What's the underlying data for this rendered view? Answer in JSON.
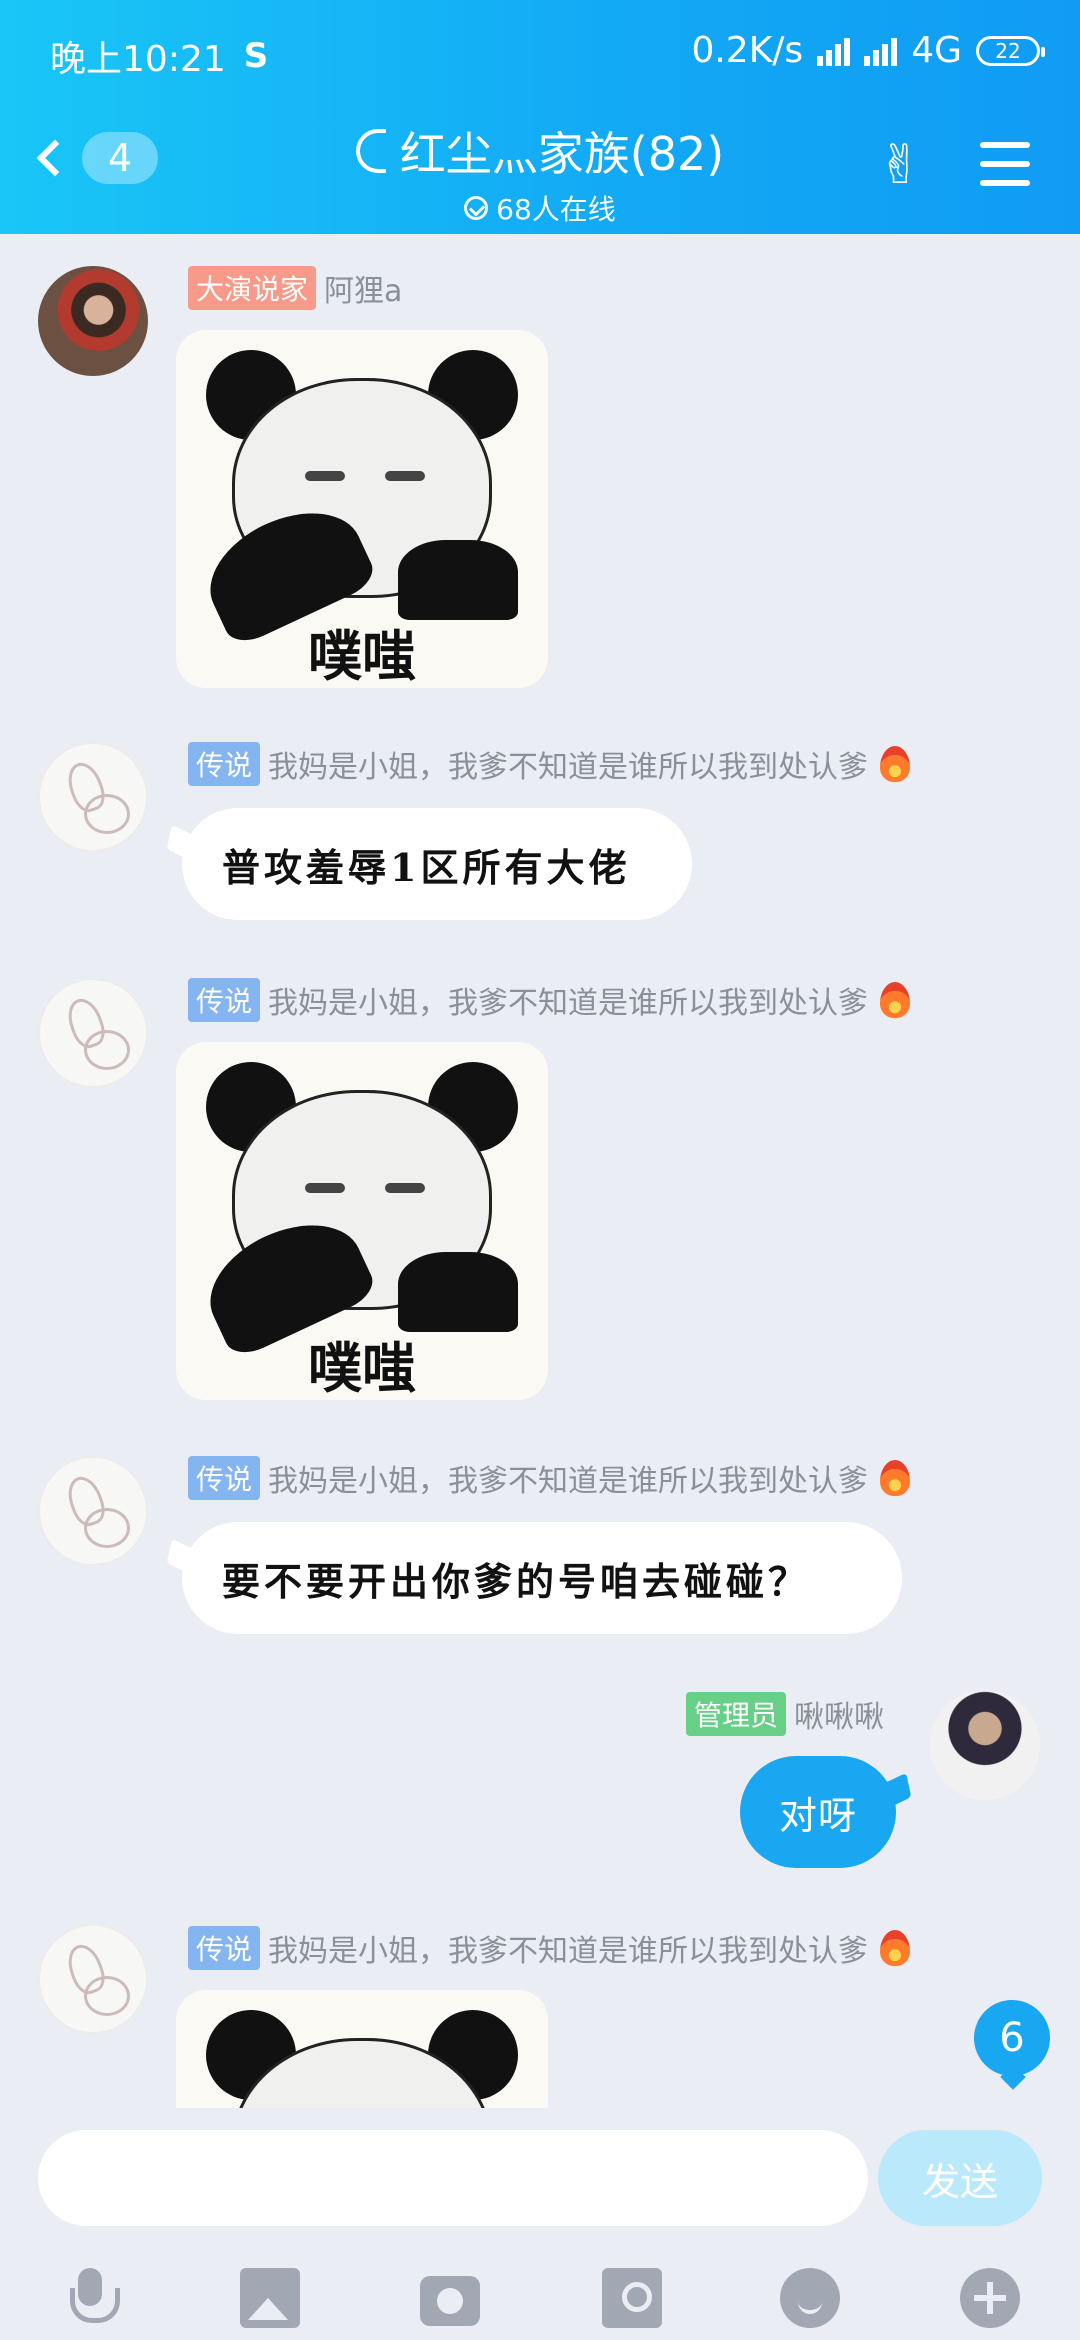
{
  "status_bar": {
    "time": "晚上10:21",
    "app_icon": "sogou-icon",
    "network_speed": "0.2K/s",
    "network_type": "4G",
    "battery": "22"
  },
  "header": {
    "back_count": "4",
    "title": "红尘灬家族(82)",
    "online": "68人在线"
  },
  "messages": [
    {
      "tag": "大演说家",
      "tag_color": "#f79a8a",
      "sender": "阿狸a",
      "type": "sticker",
      "sticker_caption": "噗嗤"
    },
    {
      "tag": "传说",
      "tag_color": "#84b5f0",
      "sender": "我妈是小姐，我爹不知道是谁所以我到处认爹",
      "type": "text",
      "text": "普攻羞辱1区所有大佬"
    },
    {
      "tag": "传说",
      "tag_color": "#84b5f0",
      "sender": "我妈是小姐，我爹不知道是谁所以我到处认爹",
      "type": "sticker",
      "sticker_caption": "噗嗤"
    },
    {
      "tag": "传说",
      "tag_color": "#84b5f0",
      "sender": "我妈是小姐，我爹不知道是谁所以我到处认爹",
      "type": "text",
      "text": "要不要开出你爹的号咱去碰碰？"
    },
    {
      "tag": "管理员",
      "tag_color": "#68cf86",
      "sender": "啾啾啾",
      "type": "text",
      "text": "对呀",
      "self": true
    },
    {
      "tag": "传说",
      "tag_color": "#84b5f0",
      "sender": "我妈是小姐，我爹不知道是谁所以我到处认爹",
      "type": "sticker",
      "sticker_caption": ""
    }
  ],
  "unread_badge": "6",
  "input": {
    "value": "",
    "placeholder": "",
    "send_label": "发送"
  },
  "toolbar": [
    "mic-icon",
    "image-icon",
    "camera-icon",
    "red-packet-icon",
    "emoji-icon",
    "plus-icon"
  ],
  "colors": {
    "accent": "#12a8f5",
    "background": "#eaedf4",
    "self_bubble": "#1aa7f1"
  }
}
